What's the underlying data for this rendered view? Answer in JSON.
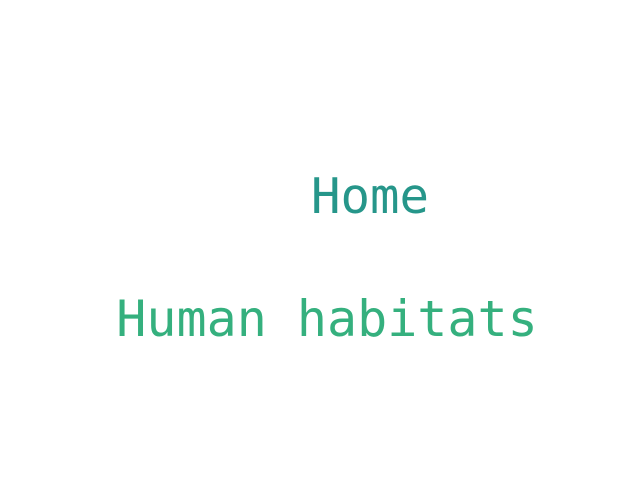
{
  "words": [
    {
      "text": "Home",
      "color": "#26968a"
    },
    {
      "text": "Human habitats",
      "color": "#35b07e"
    }
  ]
}
